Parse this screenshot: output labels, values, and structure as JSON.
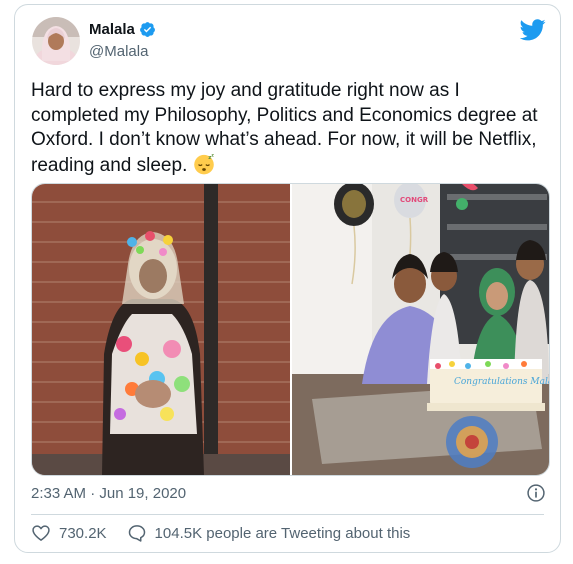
{
  "author": {
    "display_name": "Malala",
    "handle": "@Malala",
    "verified": true,
    "avatar_icon": "avatar-photo"
  },
  "tweet": {
    "text": "Hard to express my joy and gratitude right now as I completed my Philosophy, Politics and Economics degree at Oxford. I don’t know what’s ahead. For now, it will be Netflix, reading and sleep.",
    "emoji": "sleeping-face-icon"
  },
  "media": {
    "images": [
      {
        "icon": "graduate-trashed-photo"
      },
      {
        "icon": "family-cake-celebration-photo",
        "cake_text": "Congratulations Malala"
      }
    ]
  },
  "meta": {
    "timestamp": "2:33 AM · Jun 19, 2020"
  },
  "actions": {
    "likes": "730.2K",
    "tweeting": "104.5K people are Tweeting about this"
  },
  "colors": {
    "brand": "#1d9bf0",
    "secondary_text": "#536471",
    "border": "#cfd9de"
  }
}
